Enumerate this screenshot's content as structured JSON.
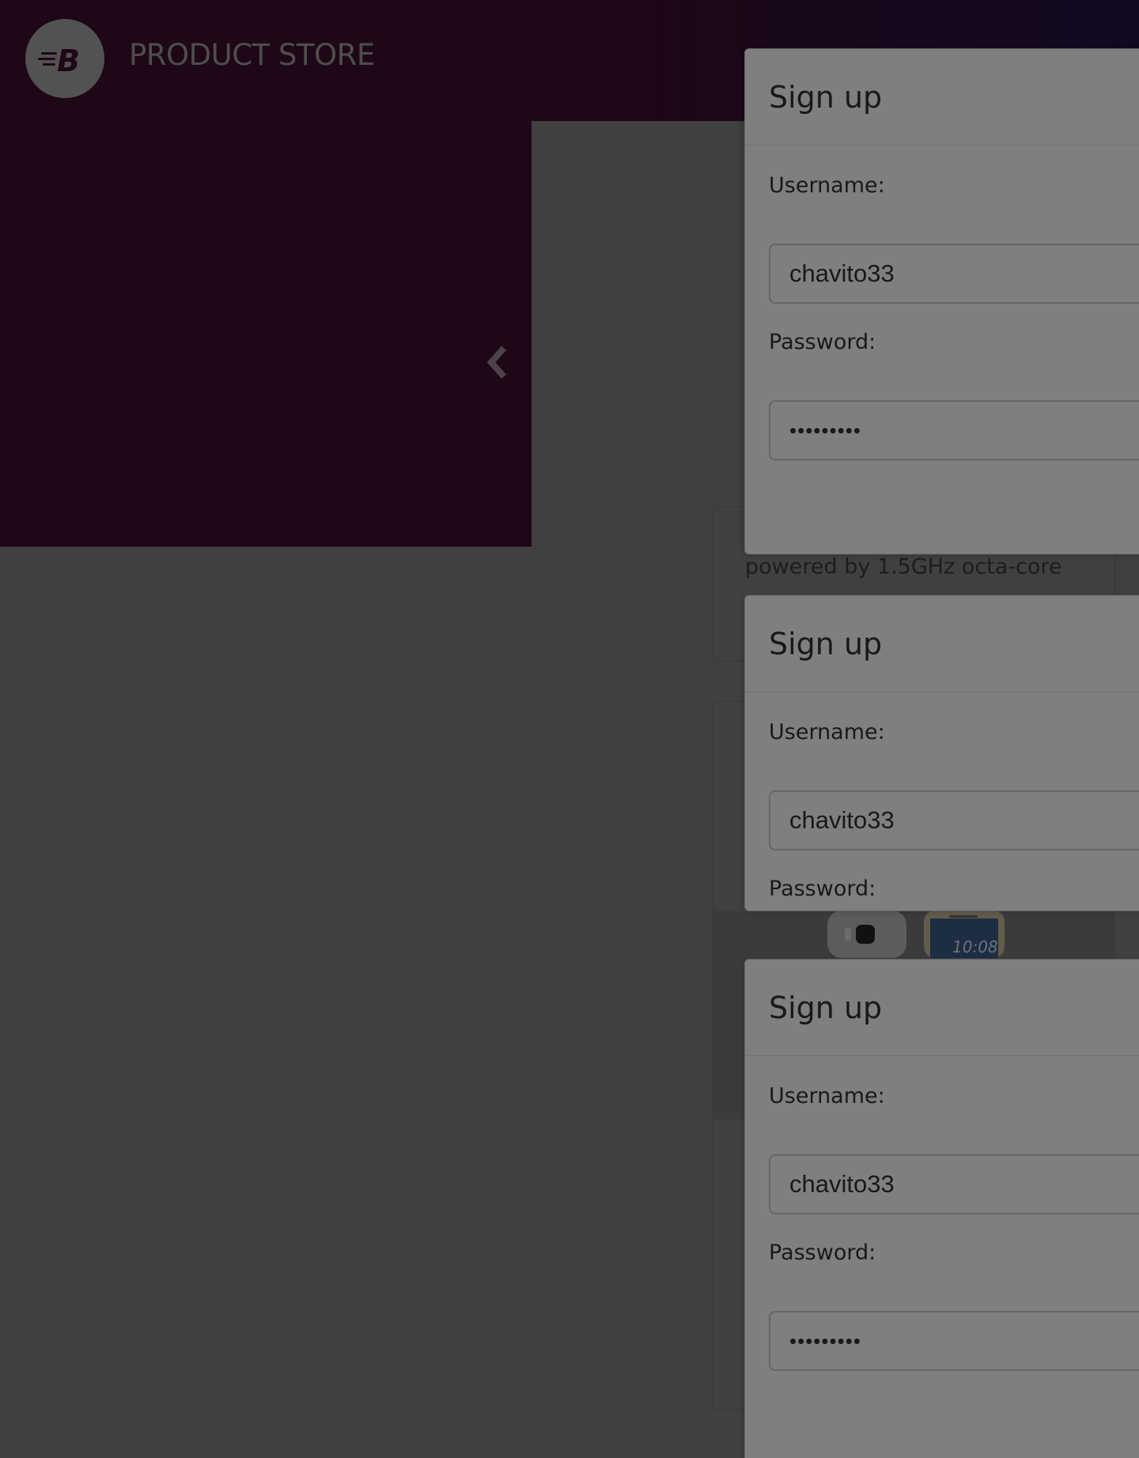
{
  "header": {
    "brand_name": "PRODUCT STORE",
    "logo_letter": "B"
  },
  "carousel": {
    "prev_icon": "chevron-left-icon"
  },
  "background_card": {
    "text": "powered by 1.5GHz octa-core",
    "phone_screen_time": "10:08"
  },
  "modals": [
    {
      "title": "Sign up",
      "username_label": "Username:",
      "username_value": "chavito33",
      "password_label": "Password:",
      "password_value": "•••••••••"
    },
    {
      "title": "Sign up",
      "username_label": "Username:",
      "username_value": "chavito33",
      "password_label": "Password:"
    },
    {
      "title": "Sign up",
      "username_label": "Username:",
      "username_value": "chavito33",
      "password_label": "Password:",
      "password_value": "•••••••••"
    }
  ],
  "colors": {
    "hero": "#3d0e2d",
    "hero_gradient_end": "#231242",
    "page_background": "#ffffff"
  }
}
